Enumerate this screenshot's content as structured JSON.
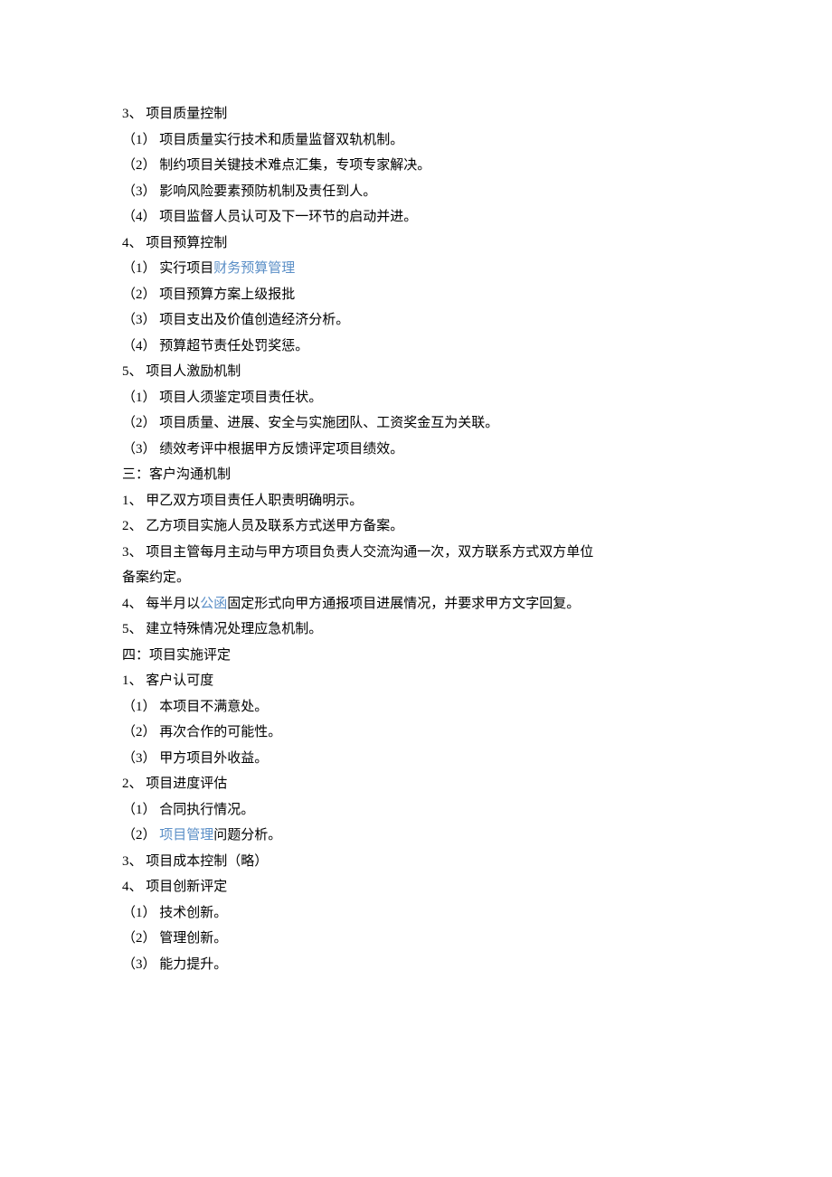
{
  "lines": [
    {
      "parts": [
        {
          "text": "3、 项目质量控制"
        }
      ]
    },
    {
      "parts": [
        {
          "text": "（1） 项目质量实行技术和质量监督双轨机制。"
        }
      ]
    },
    {
      "parts": [
        {
          "text": "（2） 制约项目关键技术难点汇集，专项专家解决。"
        }
      ]
    },
    {
      "parts": [
        {
          "text": "（3） 影响风险要素预防机制及责任到人。"
        }
      ]
    },
    {
      "parts": [
        {
          "text": "（4） 项目监督人员认可及下一环节的启动并进。"
        }
      ]
    },
    {
      "parts": [
        {
          "text": "4、 项目预算控制"
        }
      ]
    },
    {
      "parts": [
        {
          "text": "（1） 实行项目"
        },
        {
          "text": "财务预算管理",
          "link": true
        }
      ]
    },
    {
      "parts": [
        {
          "text": "（2） 项目预算方案上级报批"
        }
      ]
    },
    {
      "parts": [
        {
          "text": "（3） 项目支出及价值创造经济分析。"
        }
      ]
    },
    {
      "parts": [
        {
          "text": "（4） 预算超节责任处罚奖惩。"
        }
      ]
    },
    {
      "parts": [
        {
          "text": "5、 项目人激励机制"
        }
      ]
    },
    {
      "parts": [
        {
          "text": "（1） 项目人须鉴定项目责任状。"
        }
      ]
    },
    {
      "parts": [
        {
          "text": "（2） 项目质量、进展、安全与实施团队、工资奖金互为关联。"
        }
      ]
    },
    {
      "parts": [
        {
          "text": "（3） 绩效考评中根据甲方反馈评定项目绩效。"
        }
      ]
    },
    {
      "parts": [
        {
          "text": "三：客户沟通机制"
        }
      ]
    },
    {
      "parts": [
        {
          "text": "1、 甲乙双方项目责任人职责明确明示。"
        }
      ]
    },
    {
      "parts": [
        {
          "text": "2、 乙方项目实施人员及联系方式送甲方备案。"
        }
      ]
    },
    {
      "parts": [
        {
          "text": "3、 项目主管每月主动与甲方项目负责人交流沟通一次，双方联系方式双方单位"
        }
      ]
    },
    {
      "parts": [
        {
          "text": "备案约定。"
        }
      ]
    },
    {
      "parts": [
        {
          "text": "4、 每半月以"
        },
        {
          "text": "公函",
          "link": true
        },
        {
          "text": "固定形式向甲方通报项目进展情况，并要求甲方文字回复。"
        }
      ]
    },
    {
      "parts": [
        {
          "text": "5、 建立特殊情况处理应急机制。"
        }
      ]
    },
    {
      "parts": [
        {
          "text": "四：项目实施评定"
        }
      ]
    },
    {
      "parts": [
        {
          "text": "1、 客户认可度"
        }
      ]
    },
    {
      "parts": [
        {
          "text": "（1） 本项目不满意处。"
        }
      ]
    },
    {
      "parts": [
        {
          "text": "（2） 再次合作的可能性。"
        }
      ]
    },
    {
      "parts": [
        {
          "text": "（3） 甲方项目外收益。"
        }
      ]
    },
    {
      "parts": [
        {
          "text": "2、 项目进度评估"
        }
      ]
    },
    {
      "parts": [
        {
          "text": "（1） 合同执行情况。"
        }
      ]
    },
    {
      "parts": [
        {
          "text": "（2） "
        },
        {
          "text": "项目管理",
          "link": true
        },
        {
          "text": "问题分析。"
        }
      ]
    },
    {
      "parts": [
        {
          "text": "3、 项目成本控制（略）"
        }
      ]
    },
    {
      "parts": [
        {
          "text": "4、 项目创新评定"
        }
      ]
    },
    {
      "parts": [
        {
          "text": "（1） 技术创新。"
        }
      ]
    },
    {
      "parts": [
        {
          "text": "（2） 管理创新。"
        }
      ]
    },
    {
      "parts": [
        {
          "text": "（3） 能力提升。"
        }
      ]
    }
  ]
}
